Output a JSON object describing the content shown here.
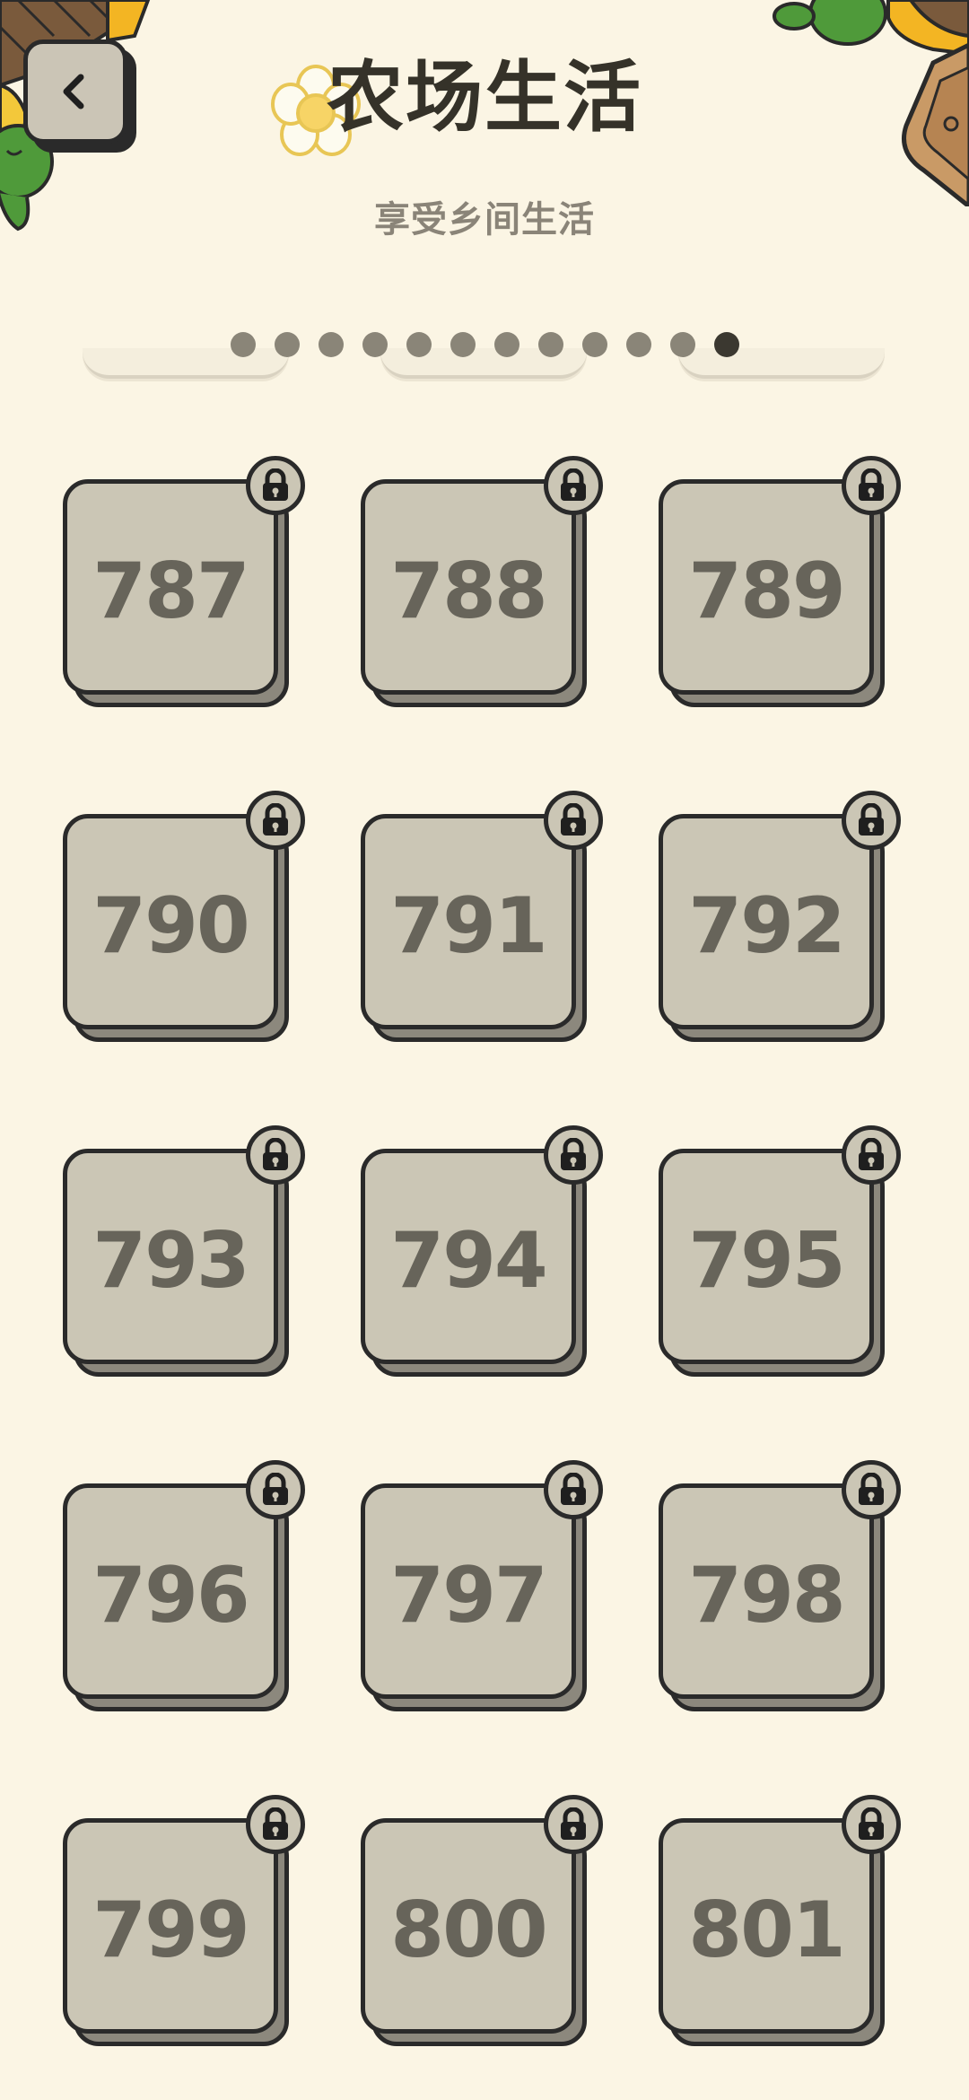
{
  "header": {
    "title": "农场生活",
    "subtitle": "享受乡间生活",
    "back_icon": "chevron-left-icon",
    "flower_icon": "daisy-flower-icon"
  },
  "pager": {
    "total_pages": 12,
    "current_page": 12
  },
  "levels": [
    {
      "number": "787",
      "locked": true
    },
    {
      "number": "788",
      "locked": true
    },
    {
      "number": "789",
      "locked": true
    },
    {
      "number": "790",
      "locked": true
    },
    {
      "number": "791",
      "locked": true
    },
    {
      "number": "792",
      "locked": true
    },
    {
      "number": "793",
      "locked": true
    },
    {
      "number": "794",
      "locked": true
    },
    {
      "number": "795",
      "locked": true
    },
    {
      "number": "796",
      "locked": true
    },
    {
      "number": "797",
      "locked": true
    },
    {
      "number": "798",
      "locked": true
    },
    {
      "number": "799",
      "locked": true
    },
    {
      "number": "800",
      "locked": true
    },
    {
      "number": "801",
      "locked": true
    }
  ],
  "colors": {
    "background": "#fbf5e4",
    "tile_face": "#cbc6b5",
    "tile_text": "#67645a",
    "outline": "#2a2a2a",
    "dot_inactive": "#8a8578",
    "dot_active": "#3b3830"
  }
}
